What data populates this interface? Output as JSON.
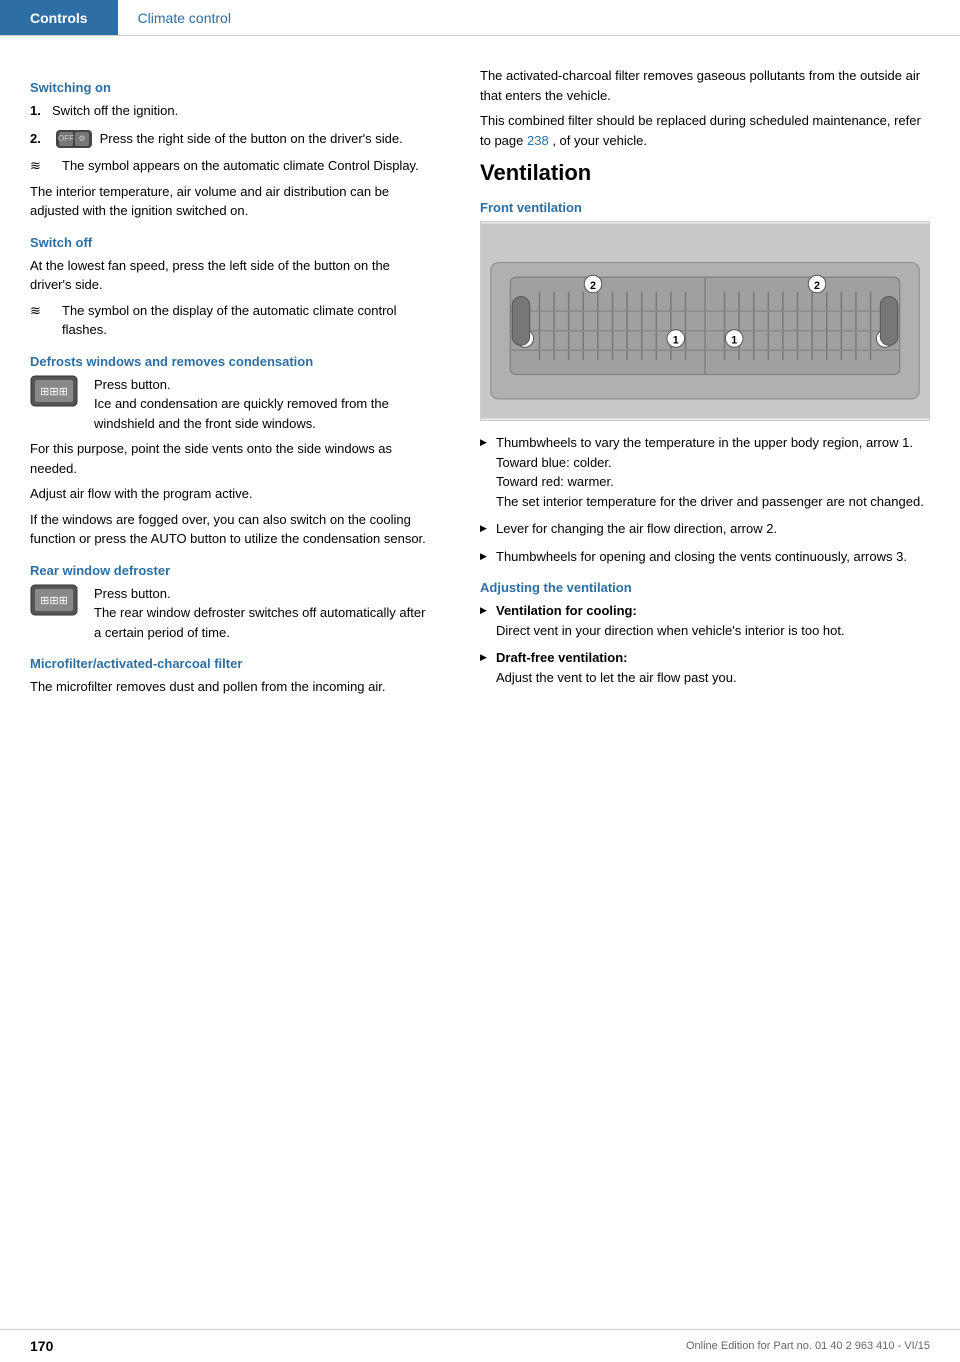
{
  "header": {
    "controls_label": "Controls",
    "climate_label": "Climate control"
  },
  "left_column": {
    "switching_on": {
      "heading": "Switching on",
      "steps": [
        {
          "num": "1.",
          "text": "Switch off the ignition."
        },
        {
          "num": "2.",
          "text": "Press the right side of the button on the driver's side."
        }
      ],
      "symbol_note": "The symbol appears on the automatic climate Control Display.",
      "body1": "The interior temperature, air volume and air distribution can be adjusted with the ignition switched on."
    },
    "switch_off": {
      "heading": "Switch off",
      "body1": "At the lowest fan speed, press the left side of the button on the driver's side.",
      "symbol_note": "The symbol on the display of the automatic climate control flashes."
    },
    "defrosts": {
      "heading": "Defrosts windows and removes condensation",
      "press_button": "Press button.",
      "body1": "Ice and condensation are quickly removed from the windshield and the front side windows.",
      "body2": "For this purpose, point the side vents onto the side windows as needed.",
      "body3": "Adjust air flow with the program active.",
      "body4": "If the windows are fogged over, you can also switch on the cooling function or press the AUTO button to utilize the condensation sensor."
    },
    "rear_window": {
      "heading": "Rear window defroster",
      "press_button": "Press button.",
      "body1": "The rear window defroster switches off automatically after a certain period of time."
    },
    "microfilter": {
      "heading": "Microfilter/activated-charcoal filter",
      "body1": "The microfilter removes dust and pollen from the incoming air."
    }
  },
  "right_column": {
    "microfilter_body2": "The activated-charcoal filter removes gaseous pollutants from the outside air that enters the vehicle.",
    "microfilter_body3": "This combined filter should be replaced during scheduled maintenance, refer to page",
    "microfilter_page_ref": "238",
    "microfilter_body3_end": ", of your vehicle.",
    "ventilation": {
      "heading": "Ventilation",
      "front_heading": "Front ventilation",
      "bullets": [
        {
          "text": "Thumbwheels to vary the temperature in the upper body region, arrow 1."
        },
        {
          "text": "Toward blue: colder."
        },
        {
          "text": "Toward red: warmer."
        },
        {
          "text": "The set interior temperature for the driver and passenger are not changed."
        },
        {
          "text": "Lever for changing the air flow direction, arrow 2."
        },
        {
          "text": "Thumbwheels for opening and closing the vents continuously, arrows 3."
        }
      ],
      "adjusting_heading": "Adjusting the ventilation",
      "adjusting_bullets": [
        {
          "label": "Ventilation for cooling:",
          "text": "Direct vent in your direction when vehicle's interior is too hot."
        },
        {
          "label": "Draft-free ventilation:",
          "text": "Adjust the vent to let the air flow past you."
        }
      ]
    }
  },
  "footer": {
    "page_number": "170",
    "info": "Online Edition for Part no. 01 40 2 963 410 - VI/15"
  }
}
